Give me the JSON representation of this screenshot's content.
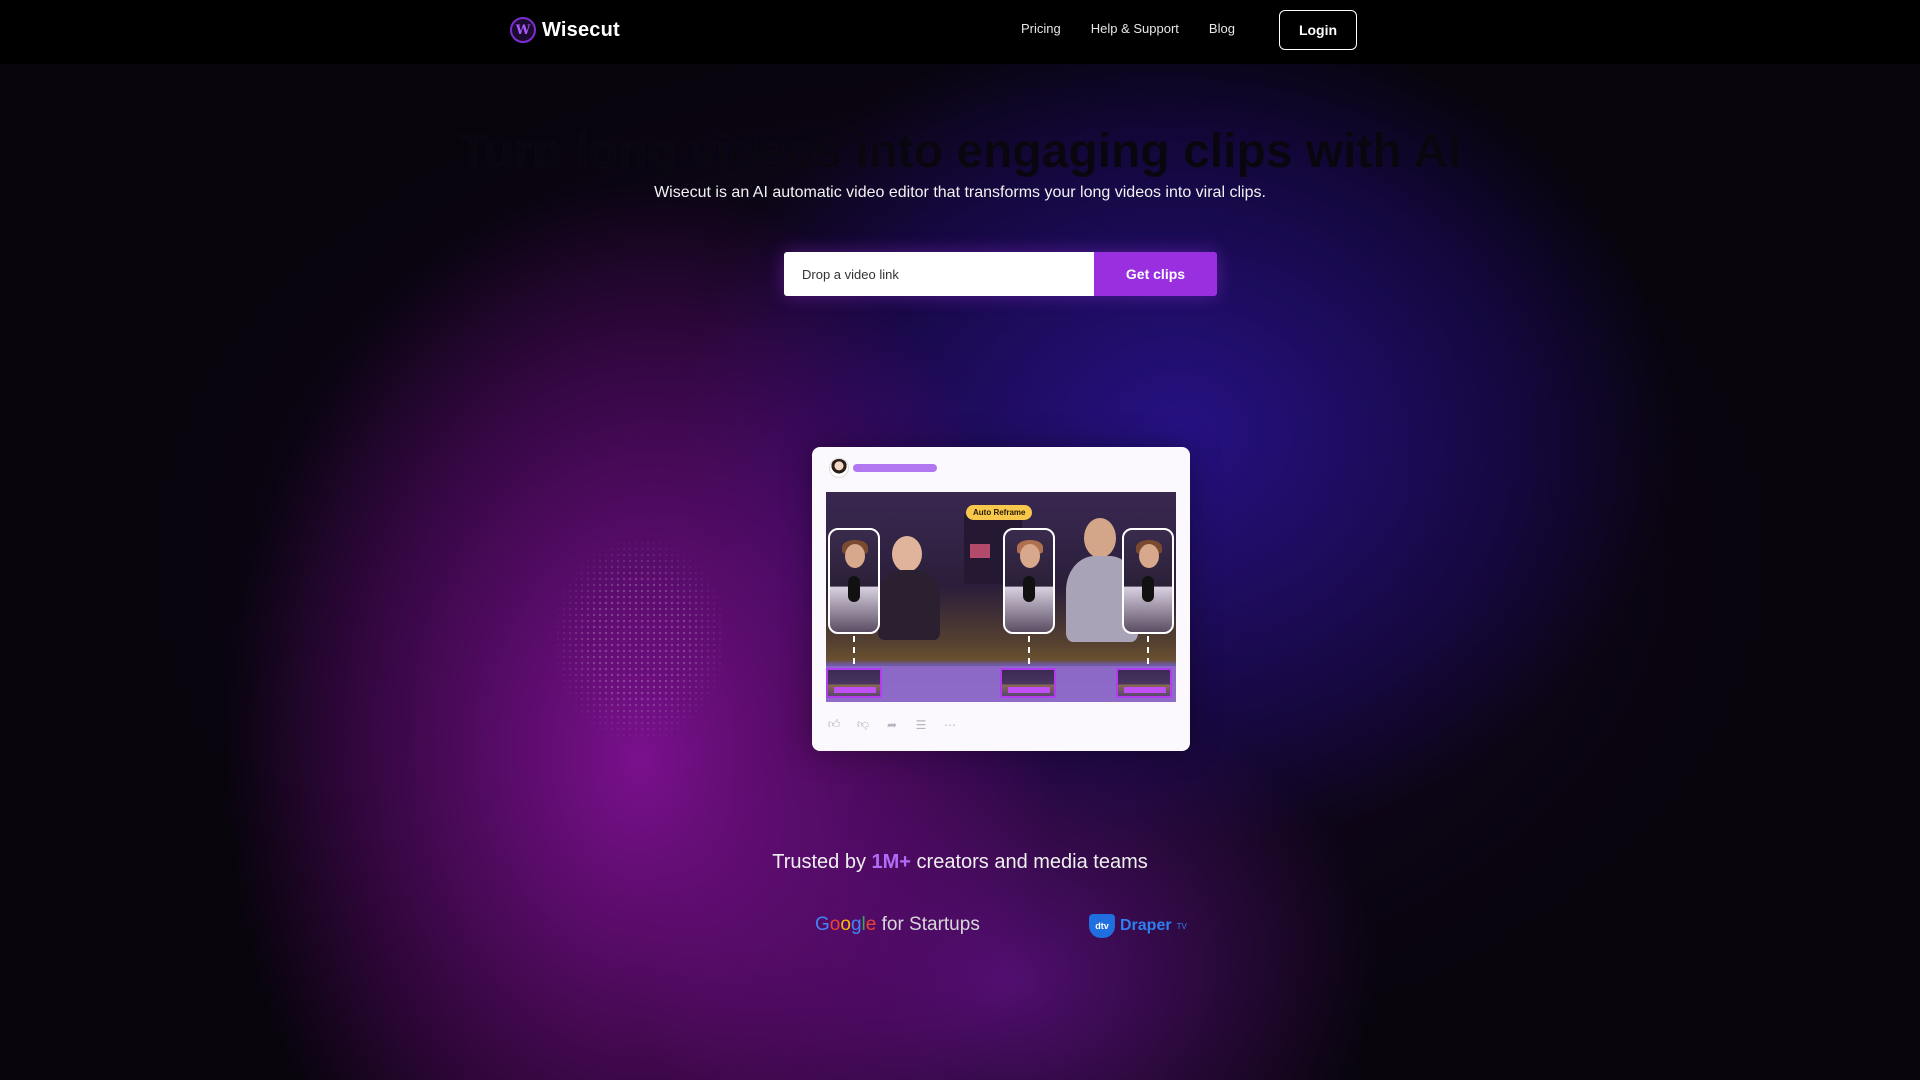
{
  "nav": {
    "logo_text": "Wisecut",
    "logo_mark": "W",
    "links": [
      "Pricing",
      "Help & Support",
      "Blog"
    ],
    "login_label": "Login"
  },
  "hero": {
    "title": "Turn long videos into engaging clips with AI",
    "subtitle": "Wisecut is an AI automatic video editor that transforms your long videos into viral clips.",
    "input_placeholder": "Drop a video link",
    "cta_label": "Get clips"
  },
  "preview": {
    "badge": "Auto Reframe",
    "actions": [
      "thumbs-up-icon",
      "thumbs-down-icon",
      "share-icon",
      "save-icon",
      "more-icon"
    ]
  },
  "trusted": {
    "prefix": "Trusted by ",
    "highlight": "1M+",
    "suffix": " creators and media teams"
  },
  "partners": {
    "google_word": "Google",
    "google_rest": " for Startups",
    "draper_badge": "dtv",
    "draper_text": "Draper",
    "draper_tv": "TV"
  },
  "colors": {
    "accent": "#9a2fe0",
    "highlight": "#b06cf5",
    "badge": "#f7c84b",
    "background": "#07040c"
  }
}
